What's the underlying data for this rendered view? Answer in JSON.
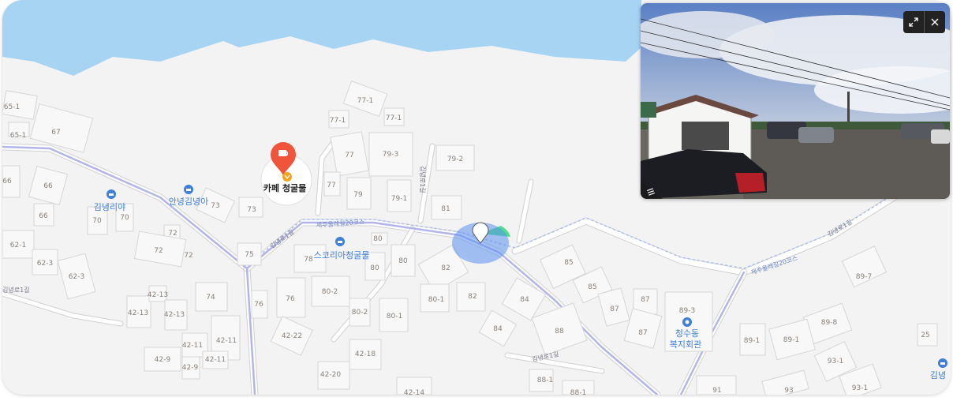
{
  "map": {
    "cafe_label": "카페 청굴물",
    "pois": [
      {
        "label": "김녕리야"
      },
      {
        "label": "안녕김녕아"
      },
      {
        "label": "스코리아청굴물"
      },
      {
        "label": "청수동"
      },
      {
        "label": "복지회관"
      },
      {
        "label": "김녕"
      }
    ],
    "road_labels": [
      "김녕로1길",
      "제주올레길20코스",
      "김녕로1길",
      "김녕로1길",
      "김녕로1길",
      "김녕로1길",
      "제주올레길20코스",
      "김녕로1길"
    ],
    "building_numbers": [
      "65-1",
      "65-1",
      "67",
      "66",
      "66",
      "66",
      "70",
      "70",
      "62-1",
      "62-3",
      "62-3",
      "72",
      "72",
      "72",
      "73",
      "73",
      "75",
      "74",
      "42-13",
      "42-13",
      "42-13",
      "42-11",
      "42-11",
      "42-11",
      "42-9",
      "42-9",
      "76",
      "76",
      "77-1",
      "77-1",
      "77-1",
      "77",
      "77",
      "79-3",
      "79",
      "79-1",
      "79-2",
      "81",
      "80",
      "78",
      "80",
      "80",
      "80-2",
      "80-2",
      "80-1",
      "80-1",
      "82",
      "82",
      "84",
      "84",
      "42-22",
      "42-18",
      "42-20",
      "42-14",
      "85",
      "85",
      "87",
      "87",
      "87",
      "88",
      "88-1",
      "88-1",
      "89-3",
      "89-7",
      "89-8",
      "89-1",
      "89-1",
      "93-1",
      "93-1",
      "91",
      "93",
      "25"
    ]
  },
  "street_view": {
    "expand_icon": "expand-icon",
    "close_icon": "close-icon",
    "menu_icon": "menu-icon"
  },
  "colors": {
    "water": "#a6d4f2",
    "land": "#f3f3f3",
    "route": "#b3b5ea",
    "cafe_marker": "#f0553c",
    "poi_blue": "#3f7fd6"
  }
}
